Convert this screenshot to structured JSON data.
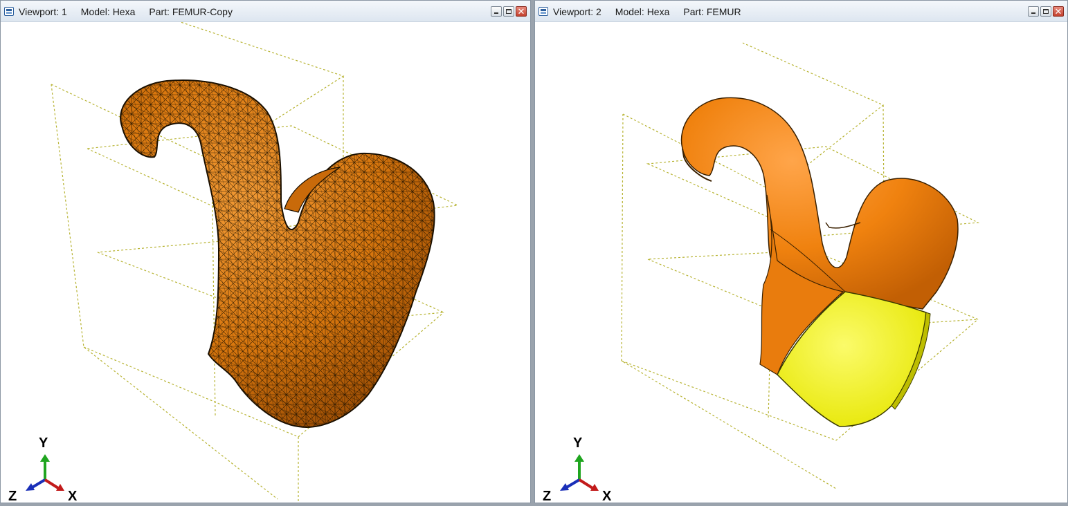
{
  "viewports": [
    {
      "title": {
        "viewport": "Viewport: 1",
        "model": "Model: Hexa",
        "part": "Part: FEMUR-Copy"
      },
      "icon": "viewport-icon",
      "window_buttons": [
        "minimize-icon",
        "restore-icon",
        "close-icon"
      ],
      "triad": {
        "y": "Y",
        "z": "Z",
        "x": "X"
      }
    },
    {
      "title": {
        "viewport": "Viewport: 2",
        "model": "Model: Hexa",
        "part": "Part: FEMUR"
      },
      "icon": "viewport-icon",
      "window_buttons": [
        "minimize-icon",
        "restore-icon",
        "close-icon"
      ],
      "triad": {
        "y": "Y",
        "z": "Z",
        "x": "X"
      }
    }
  ],
  "colors": {
    "part_orange": "#e07b0f",
    "section_yellow": "#f2f20a",
    "bounding_box": "#b7b332",
    "axis_y": "#1fa51f",
    "axis_z": "#1a2fb8",
    "axis_x": "#c21b1b"
  },
  "close_glyph": "✕"
}
